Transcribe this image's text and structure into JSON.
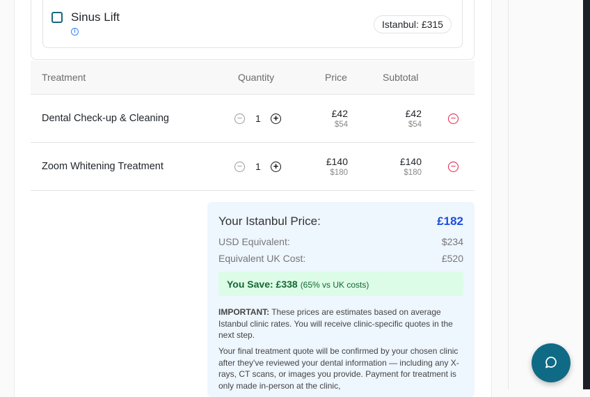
{
  "option": {
    "label": "Sinus Lift",
    "price_badge": "Istanbul: £315",
    "checked": false
  },
  "table": {
    "headers": [
      "Treatment",
      "Quantity",
      "Price",
      "Subtotal"
    ],
    "rows": [
      {
        "name": "Dental Check-up & Cleaning",
        "qty": "1",
        "price_gbp": "£42",
        "price_usd": "$54",
        "subtotal_gbp": "£42",
        "subtotal_usd": "$54"
      },
      {
        "name": "Zoom Whitening Treatment",
        "qty": "1",
        "price_gbp": "£140",
        "price_usd": "$180",
        "subtotal_gbp": "£140",
        "subtotal_usd": "$180"
      }
    ]
  },
  "summary": {
    "title": "Your Istanbul Price:",
    "total": "£182",
    "usd_label": "USD Equivalent:",
    "usd_value": "$234",
    "uk_label": "Equivalent UK Cost:",
    "uk_value": "£520",
    "save_label": "You Save: £338",
    "save_note": "(65% vs UK costs)",
    "important_label": "IMPORTANT:",
    "important_text": " These prices are estimates based on average Istanbul clinic rates. You will receive clinic-specific quotes in the next step.",
    "final_note": "Your final treatment quote will be confirmed by your chosen clinic after they've reviewed your dental information — including any X-rays, CT scans, or images you provide. Payment for treatment is only made in-person at the clinic,"
  },
  "colors": {
    "accent": "#1d4ed8",
    "teal": "#0f6b85",
    "danger": "#e11d48",
    "save_bg": "#dcfce7"
  }
}
